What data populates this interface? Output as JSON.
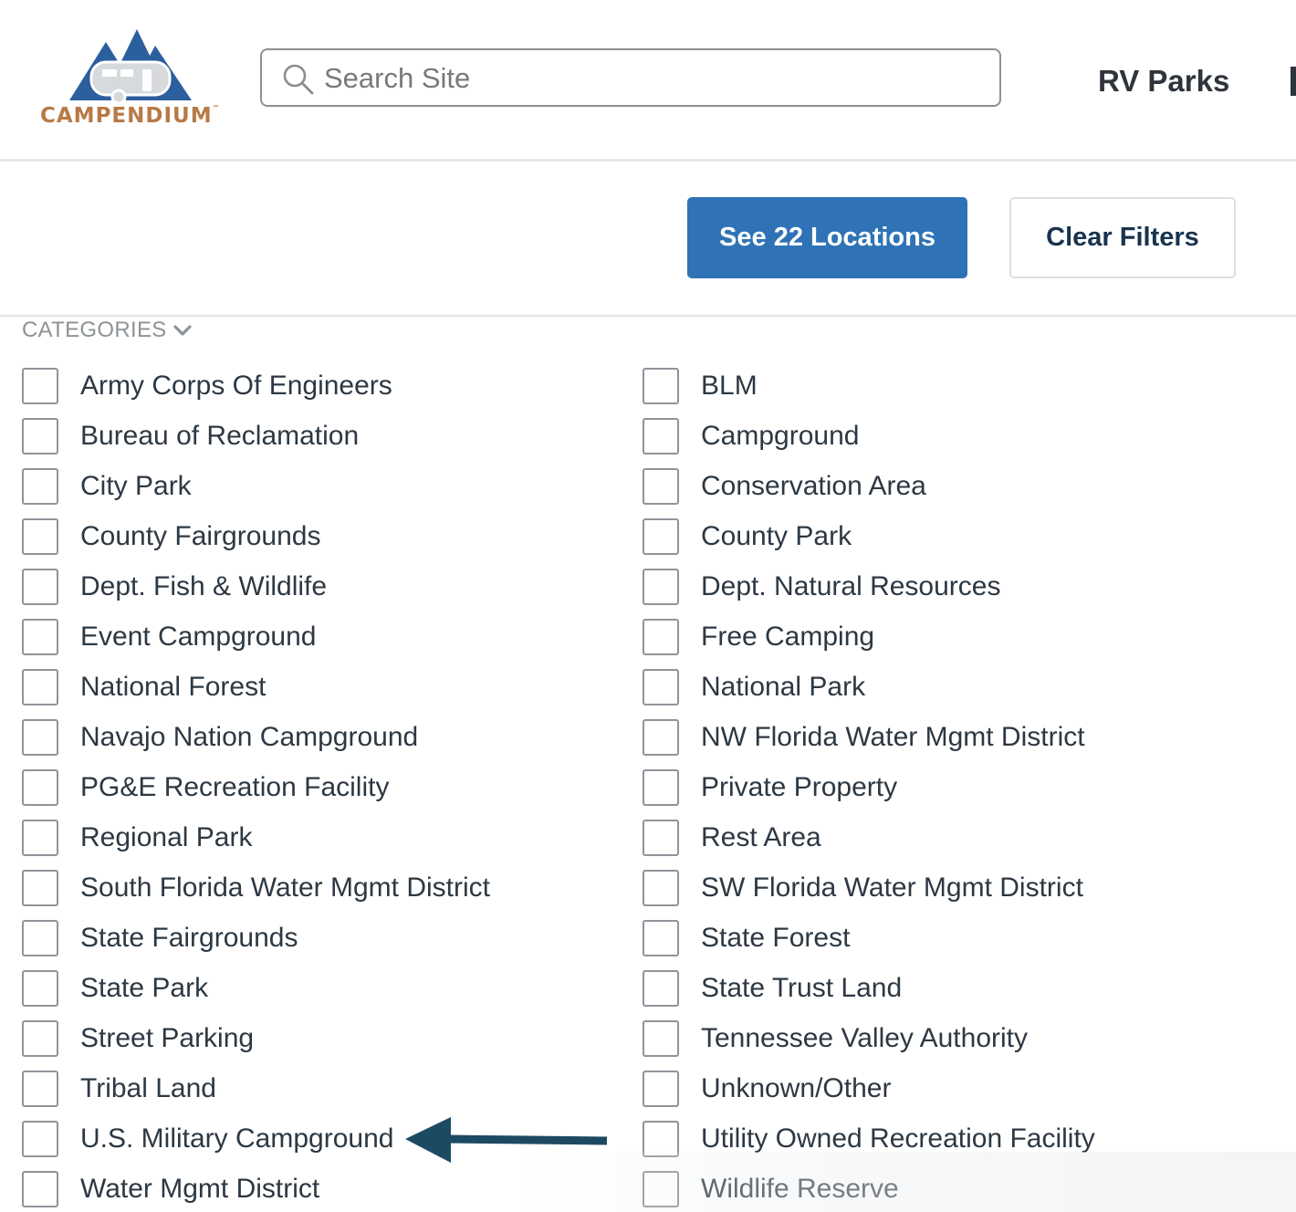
{
  "brand": {
    "name": "CAMPENDIUM",
    "trademark": "™",
    "colors": {
      "primary_blue": "#2c5f9e",
      "text_copper": "#b87a46"
    }
  },
  "header": {
    "search": {
      "placeholder": "Search Site",
      "value": ""
    },
    "nav": {
      "rv_parks": "RV Parks"
    }
  },
  "actions": {
    "see_locations": "See 22 Locations",
    "clear_filters": "Clear Filters",
    "accent_color": "#2f73b6"
  },
  "categories": {
    "header": "CATEGORIES",
    "left": [
      {
        "label": "Army Corps Of Engineers",
        "checked": false
      },
      {
        "label": "Bureau of Reclamation",
        "checked": false
      },
      {
        "label": "City Park",
        "checked": false
      },
      {
        "label": "County Fairgrounds",
        "checked": false
      },
      {
        "label": "Dept. Fish & Wildlife",
        "checked": false
      },
      {
        "label": "Event Campground",
        "checked": false
      },
      {
        "label": "National Forest",
        "checked": false
      },
      {
        "label": "Navajo Nation Campground",
        "checked": false
      },
      {
        "label": "PG&E Recreation Facility",
        "checked": false
      },
      {
        "label": "Regional Park",
        "checked": false
      },
      {
        "label": "South Florida Water Mgmt District",
        "checked": false
      },
      {
        "label": "State Fairgrounds",
        "checked": false
      },
      {
        "label": "State Park",
        "checked": false
      },
      {
        "label": "Street Parking",
        "checked": false
      },
      {
        "label": "Tribal Land",
        "checked": false
      },
      {
        "label": "U.S. Military Campground",
        "checked": false
      },
      {
        "label": "Water Mgmt District",
        "checked": false
      }
    ],
    "right": [
      {
        "label": "BLM",
        "checked": false
      },
      {
        "label": "Campground",
        "checked": false
      },
      {
        "label": "Conservation Area",
        "checked": false
      },
      {
        "label": "County Park",
        "checked": false
      },
      {
        "label": "Dept. Natural Resources",
        "checked": false
      },
      {
        "label": "Free Camping",
        "checked": false
      },
      {
        "label": "National Park",
        "checked": false
      },
      {
        "label": "NW Florida Water Mgmt District",
        "checked": false
      },
      {
        "label": "Private Property",
        "checked": false
      },
      {
        "label": "Rest Area",
        "checked": false
      },
      {
        "label": "SW Florida Water Mgmt District",
        "checked": false
      },
      {
        "label": "State Forest",
        "checked": false
      },
      {
        "label": "State Trust Land",
        "checked": false
      },
      {
        "label": "Tennessee Valley Authority",
        "checked": false
      },
      {
        "label": "Unknown/Other",
        "checked": false
      },
      {
        "label": "Utility Owned Recreation Facility",
        "checked": false
      },
      {
        "label": "Wildlife Reserve",
        "checked": false
      }
    ]
  },
  "annotation": {
    "arrow_icon": "left-arrow-icon",
    "color": "#1d4a63"
  }
}
